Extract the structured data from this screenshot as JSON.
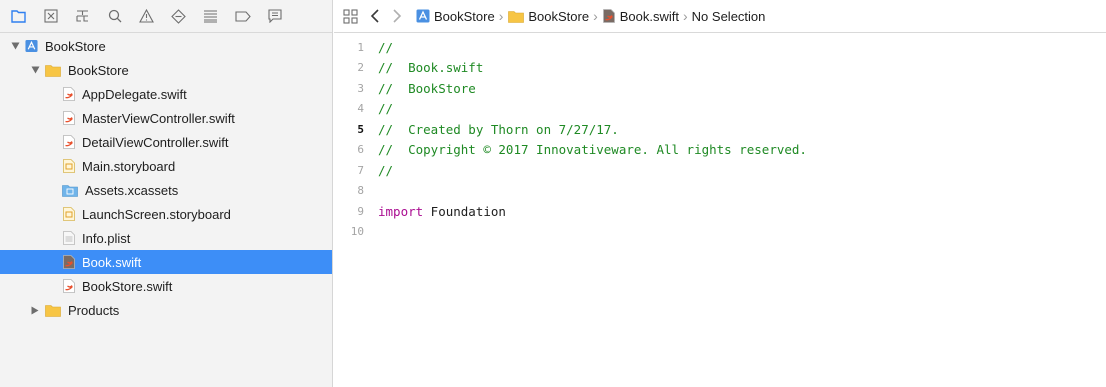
{
  "navigator": {
    "toolbar": [
      {
        "icon": "project-navigator-icon",
        "active": true
      },
      {
        "icon": "source-control-icon"
      },
      {
        "icon": "symbol-navigator-icon"
      },
      {
        "icon": "find-navigator-icon"
      },
      {
        "icon": "issue-navigator-icon"
      },
      {
        "icon": "test-navigator-icon"
      },
      {
        "icon": "debug-navigator-icon"
      },
      {
        "icon": "breakpoint-navigator-icon"
      },
      {
        "icon": "report-navigator-icon"
      }
    ],
    "tree": [
      {
        "label": "BookStore",
        "type": "project",
        "expanded": true,
        "level": 0
      },
      {
        "label": "BookStore",
        "type": "folder",
        "expanded": true,
        "level": 1
      },
      {
        "label": "AppDelegate.swift",
        "type": "swift",
        "level": 2
      },
      {
        "label": "MasterViewController.swift",
        "type": "swift",
        "level": 2
      },
      {
        "label": "DetailViewController.swift",
        "type": "swift",
        "level": 2
      },
      {
        "label": "Main.storyboard",
        "type": "storyboard",
        "level": 2
      },
      {
        "label": "Assets.xcassets",
        "type": "assets",
        "level": 2
      },
      {
        "label": "LaunchScreen.storyboard",
        "type": "storyboard",
        "level": 2
      },
      {
        "label": "Info.plist",
        "type": "plist",
        "level": 2
      },
      {
        "label": "Book.swift",
        "type": "swift",
        "level": 2,
        "selected": true
      },
      {
        "label": "BookStore.swift",
        "type": "swift",
        "level": 2
      },
      {
        "label": "Products",
        "type": "folder",
        "expanded": false,
        "level": 1
      }
    ]
  },
  "jumpbar": {
    "crumbs": [
      {
        "label": "BookStore",
        "icon": "project-icon"
      },
      {
        "label": "BookStore",
        "icon": "folder-icon"
      },
      {
        "label": "Book.swift",
        "icon": "swift-file-icon"
      },
      {
        "label": "No Selection",
        "icon": ""
      }
    ]
  },
  "editor": {
    "current_line": 5,
    "lines": [
      {
        "n": "1",
        "parts": [
          {
            "t": "//",
            "k": "comment"
          }
        ]
      },
      {
        "n": "2",
        "parts": [
          {
            "t": "//  Book.swift",
            "k": "comment"
          }
        ]
      },
      {
        "n": "3",
        "parts": [
          {
            "t": "//  BookStore",
            "k": "comment"
          }
        ]
      },
      {
        "n": "4",
        "parts": [
          {
            "t": "//",
            "k": "comment"
          }
        ]
      },
      {
        "n": "5",
        "parts": [
          {
            "t": "//  Created by Thorn on 7/27/17.",
            "k": "comment"
          }
        ]
      },
      {
        "n": "6",
        "parts": [
          {
            "t": "//  Copyright © 2017 Innovativeware. All rights reserved.",
            "k": "comment"
          }
        ]
      },
      {
        "n": "7",
        "parts": [
          {
            "t": "//",
            "k": "comment"
          }
        ]
      },
      {
        "n": "8",
        "parts": []
      },
      {
        "n": "9",
        "parts": [
          {
            "t": "import",
            "k": "keyword"
          },
          {
            "t": " Foundation",
            "k": "text"
          }
        ]
      },
      {
        "n": "10",
        "parts": []
      }
    ]
  },
  "colors": {
    "selection": "#3d8ef7",
    "comment": "#1f8a24",
    "keyword": "#aa0d91",
    "folder": "#f7c544",
    "project": "#4a90e2",
    "swift": "#e8502d"
  }
}
